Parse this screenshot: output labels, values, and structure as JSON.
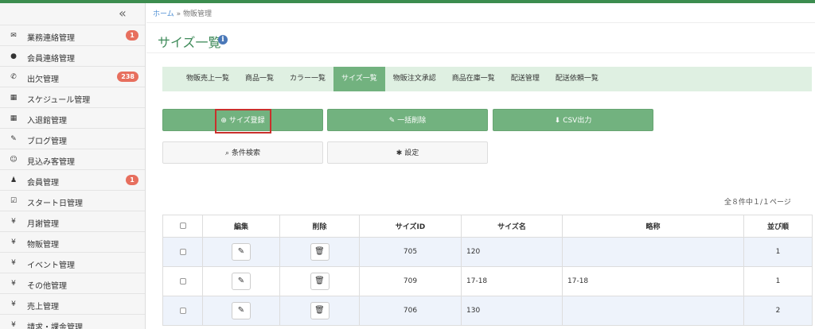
{
  "sidebar": {
    "collapse_glyph": "«",
    "items": [
      {
        "icon": "envelope-icon",
        "glyph": "✉",
        "label": "業務連絡管理",
        "badge": "1"
      },
      {
        "icon": "comment-icon",
        "glyph": "●",
        "label": "会員連絡管理",
        "badge": ""
      },
      {
        "icon": "phone-icon",
        "glyph": "✆",
        "label": "出欠管理",
        "badge": "238"
      },
      {
        "icon": "calendar-icon",
        "glyph": "▦",
        "label": "スケジュール管理",
        "badge": ""
      },
      {
        "icon": "calendar-icon",
        "glyph": "▦",
        "label": "入退館管理",
        "badge": ""
      },
      {
        "icon": "pencil-icon",
        "glyph": "✎",
        "label": "ブログ管理",
        "badge": ""
      },
      {
        "icon": "smile-icon",
        "glyph": "☺",
        "label": "見込み客管理",
        "badge": ""
      },
      {
        "icon": "user-icon",
        "glyph": "♟",
        "label": "会員管理",
        "badge": "1"
      },
      {
        "icon": "check-square-icon",
        "glyph": "☑",
        "label": "スタート日管理",
        "badge": ""
      },
      {
        "icon": "yen-icon",
        "glyph": "¥",
        "label": "月謝管理",
        "badge": ""
      },
      {
        "icon": "yen-icon",
        "glyph": "¥",
        "label": "物販管理",
        "badge": ""
      },
      {
        "icon": "yen-icon",
        "glyph": "¥",
        "label": "イベント管理",
        "badge": ""
      },
      {
        "icon": "yen-icon",
        "glyph": "¥",
        "label": "その他管理",
        "badge": ""
      },
      {
        "icon": "yen-icon",
        "glyph": "¥",
        "label": "売上管理",
        "badge": ""
      },
      {
        "icon": "yen-icon",
        "glyph": "¥",
        "label": "請求・課金管理",
        "badge": ""
      }
    ]
  },
  "breadcrumb": {
    "home": "ホーム",
    "separator": "»",
    "current": "物販管理"
  },
  "page": {
    "title": "サイズ一覧",
    "info_glyph": "i"
  },
  "tabs": [
    {
      "label": "物販売上一覧",
      "active": false
    },
    {
      "label": "商品一覧",
      "active": false
    },
    {
      "label": "カラー一覧",
      "active": false
    },
    {
      "label": "サイズ一覧",
      "active": true
    },
    {
      "label": "物販注文承認",
      "active": false
    },
    {
      "label": "商品在庫一覧",
      "active": false
    },
    {
      "label": "配送管理",
      "active": false
    },
    {
      "label": "配送依頼一覧",
      "active": false
    }
  ],
  "buttons": {
    "register": {
      "label": "サイズ登録",
      "glyph": "⊕"
    },
    "bulk_delete": {
      "label": "一括削除",
      "glyph": "✎"
    },
    "csv": {
      "label": "CSV出力",
      "glyph": "⬇"
    },
    "search": {
      "label": "条件検索",
      "glyph": "⌕"
    },
    "settings": {
      "label": "設定",
      "glyph": "✱"
    }
  },
  "pagination_text": "全８件中１/１ページ",
  "table": {
    "headers": [
      "",
      "編集",
      "削除",
      "サイズID",
      "サイズ名",
      "略称",
      "並び順"
    ],
    "edit_glyph": "✎",
    "delete_glyph": "🗑",
    "rows": [
      {
        "id": "705",
        "name": "120",
        "abbr": "",
        "order": "1"
      },
      {
        "id": "709",
        "name": "17-18",
        "abbr": "17-18",
        "order": "1"
      },
      {
        "id": "706",
        "name": "130",
        "abbr": "",
        "order": "2"
      }
    ]
  },
  "colors": {
    "accent": "#72b27f",
    "tab_bg": "#dff0e2",
    "title": "#3f8b5a",
    "badge": "#e76f5e",
    "highlight": "#c9302c"
  }
}
